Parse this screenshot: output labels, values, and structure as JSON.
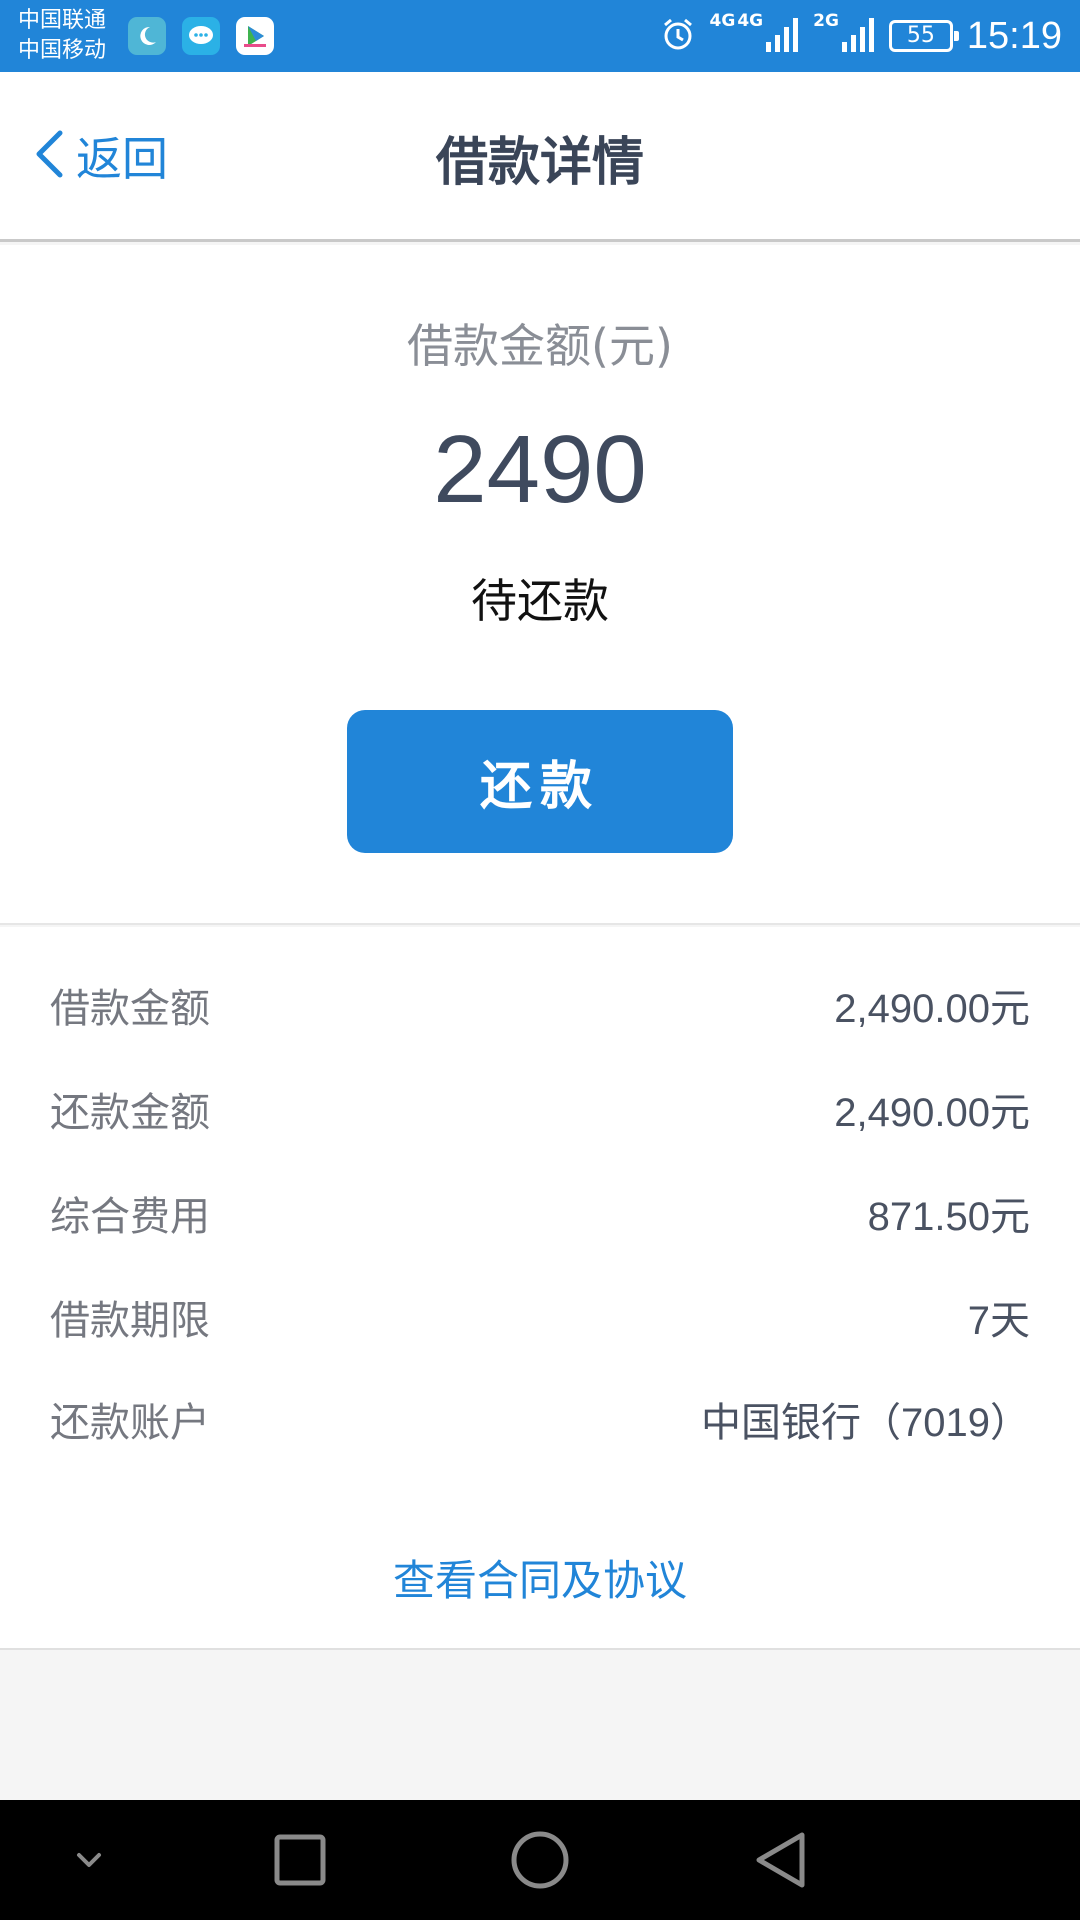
{
  "status_bar": {
    "carrier_1": "中国联通",
    "carrier_2": "中国移动",
    "network_1": "4G",
    "network_2": "4G",
    "network_3": "2G",
    "battery": "55",
    "time": "15:19",
    "icons": [
      "moon-app-icon",
      "message-app-icon",
      "video-app-icon",
      "alarm-icon",
      "signal-icon"
    ]
  },
  "header": {
    "back_label": "返回",
    "title": "借款详情"
  },
  "summary": {
    "amount_label": "借款金额(元)",
    "amount": "2490",
    "status": "待还款",
    "repay_label": "还款"
  },
  "details": {
    "rows": [
      {
        "label": "借款金额",
        "value": "2,490.00元"
      },
      {
        "label": "还款金额",
        "value": "2,490.00元"
      },
      {
        "label": "综合费用",
        "value": "871.50元"
      },
      {
        "label": "借款期限",
        "value": "7天"
      },
      {
        "label": "还款账户",
        "value": "中国银行（7019）"
      }
    ],
    "contract_link": "查看合同及协议"
  },
  "colors": {
    "accent": "#2185d8",
    "title": "#3a4558",
    "amount": "#3f4a5e"
  }
}
